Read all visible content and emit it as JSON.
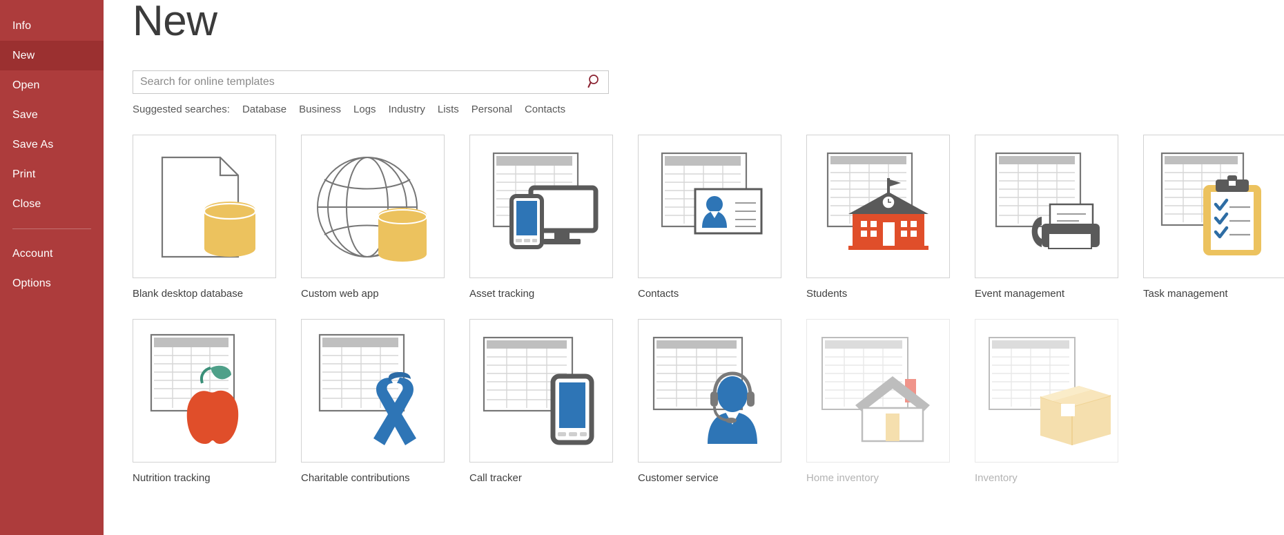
{
  "window": {
    "app": "Microsoft Access",
    "backstage": true
  },
  "sidebar": {
    "background_color": "#ad3c3c",
    "active_color": "#9b3030",
    "items": [
      {
        "label": "Info",
        "active": false
      },
      {
        "label": "New",
        "active": true
      },
      {
        "label": "Open",
        "active": false
      },
      {
        "label": "Save",
        "active": false
      },
      {
        "label": "Save As",
        "active": false
      },
      {
        "label": "Print",
        "active": false
      },
      {
        "label": "Close",
        "active": false
      }
    ],
    "bottom_items": [
      {
        "label": "Account"
      },
      {
        "label": "Options"
      }
    ]
  },
  "header": {
    "title": "New"
  },
  "search": {
    "placeholder": "Search for online templates",
    "value": "",
    "icon": "search-icon",
    "icon_color": "#8b2331"
  },
  "suggested": {
    "label": "Suggested searches:",
    "links": [
      "Database",
      "Business",
      "Logs",
      "Industry",
      "Lists",
      "Personal",
      "Contacts"
    ]
  },
  "templates": {
    "row1": [
      {
        "label": "Blank desktop database",
        "icon": "blank-database-icon",
        "faded": false
      },
      {
        "label": "Custom web app",
        "icon": "globe-database-icon",
        "faded": false
      },
      {
        "label": "Asset tracking",
        "icon": "monitor-phone-icon",
        "faded": false
      },
      {
        "label": "Contacts",
        "icon": "contact-card-icon",
        "faded": false
      },
      {
        "label": "Students",
        "icon": "schoolhouse-icon",
        "faded": false
      },
      {
        "label": "Event management",
        "icon": "fax-machine-icon",
        "faded": false
      },
      {
        "label": "Task management",
        "icon": "clipboard-check-icon",
        "faded": false
      }
    ],
    "row2": [
      {
        "label": "Nutrition tracking",
        "icon": "apple-icon",
        "faded": false
      },
      {
        "label": "Charitable contributions",
        "icon": "ribbon-icon",
        "faded": false
      },
      {
        "label": "Call tracker",
        "icon": "smartphone-icon",
        "faded": false
      },
      {
        "label": "Customer service",
        "icon": "headset-agent-icon",
        "faded": false
      },
      {
        "label": "Home inventory",
        "icon": "house-icon",
        "faded": true
      },
      {
        "label": "Inventory",
        "icon": "box-icon",
        "faded": true
      }
    ]
  },
  "colors": {
    "accent_red": "#ad3c3c",
    "gold": "#ecc25e",
    "blue": "#2e75b6",
    "orange_red": "#e04e2a",
    "gray_line": "#767676",
    "table_header": "#b5b5b5"
  }
}
